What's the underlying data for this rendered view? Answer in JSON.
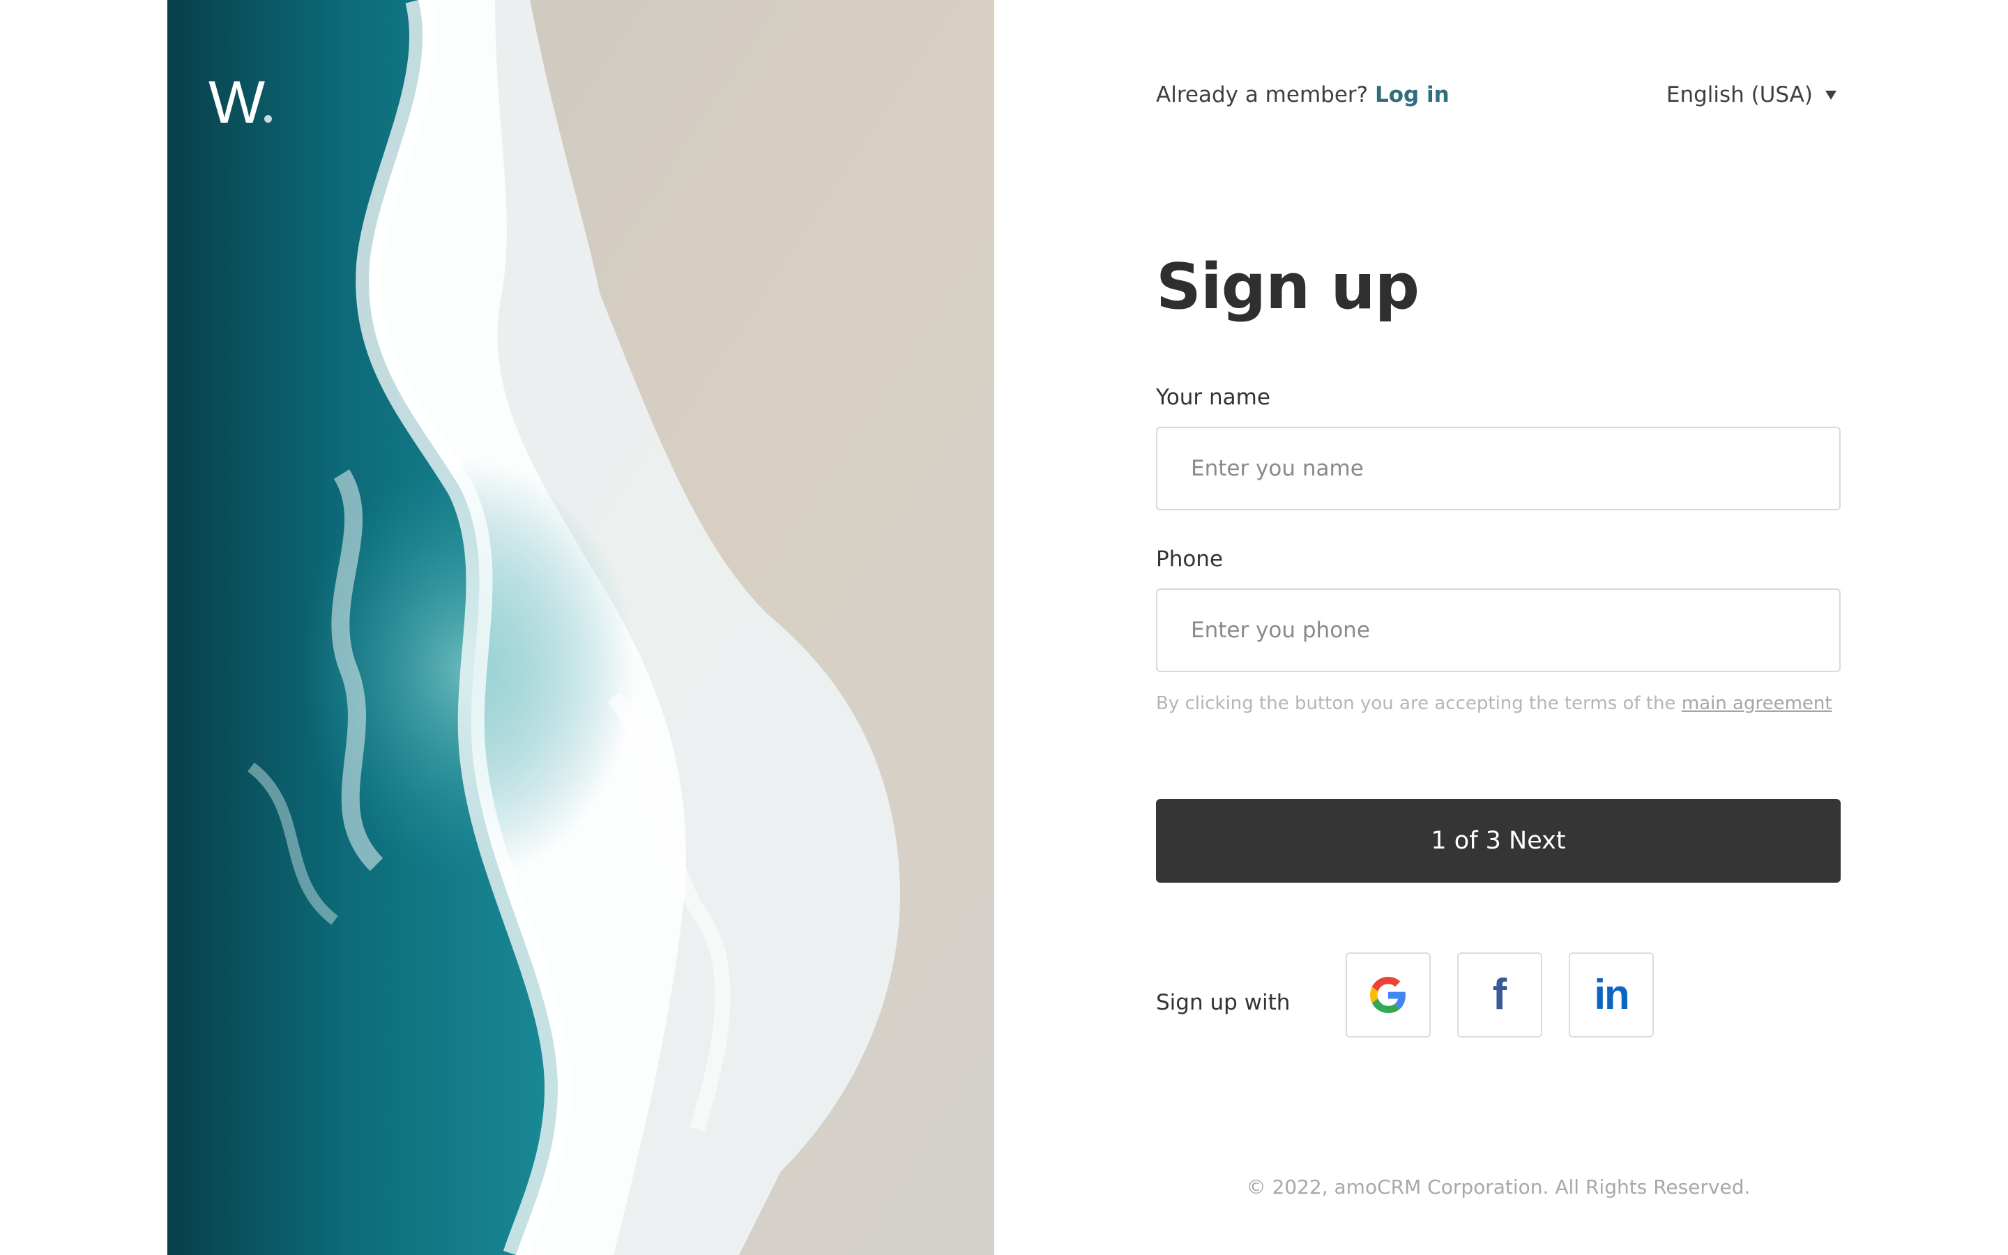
{
  "brand": {
    "logo_letter": "W"
  },
  "header": {
    "member_prompt": "Already a member?",
    "login_label": "Log in",
    "language": "English (USA)"
  },
  "form": {
    "title": "Sign up",
    "name_label": "Your name",
    "name_placeholder": "Enter you name",
    "name_value": "",
    "phone_label": "Phone",
    "phone_placeholder": "Enter you phone",
    "phone_value": "",
    "terms_text": "By clicking the button you are accepting the terms of the",
    "terms_link": "main agreement",
    "submit_label": "1 of 3 Next"
  },
  "social": {
    "label": "Sign up with",
    "providers": [
      {
        "name": "Google",
        "icon": "google-icon"
      },
      {
        "name": "Facebook",
        "icon": "facebook-icon",
        "glyph": "f"
      },
      {
        "name": "LinkedIn",
        "icon": "linkedin-icon",
        "glyph": "in"
      }
    ]
  },
  "footer": {
    "copyright": "© 2022, amoCRM Corporation. All Rights Reserved."
  },
  "colors": {
    "login_link": "#2f6e7f",
    "button_bg": "#353535",
    "facebook": "#3b5998",
    "linkedin": "#0a66c2",
    "ocean_dark": "#0b4f5c",
    "sand": "#d6d2ca"
  }
}
